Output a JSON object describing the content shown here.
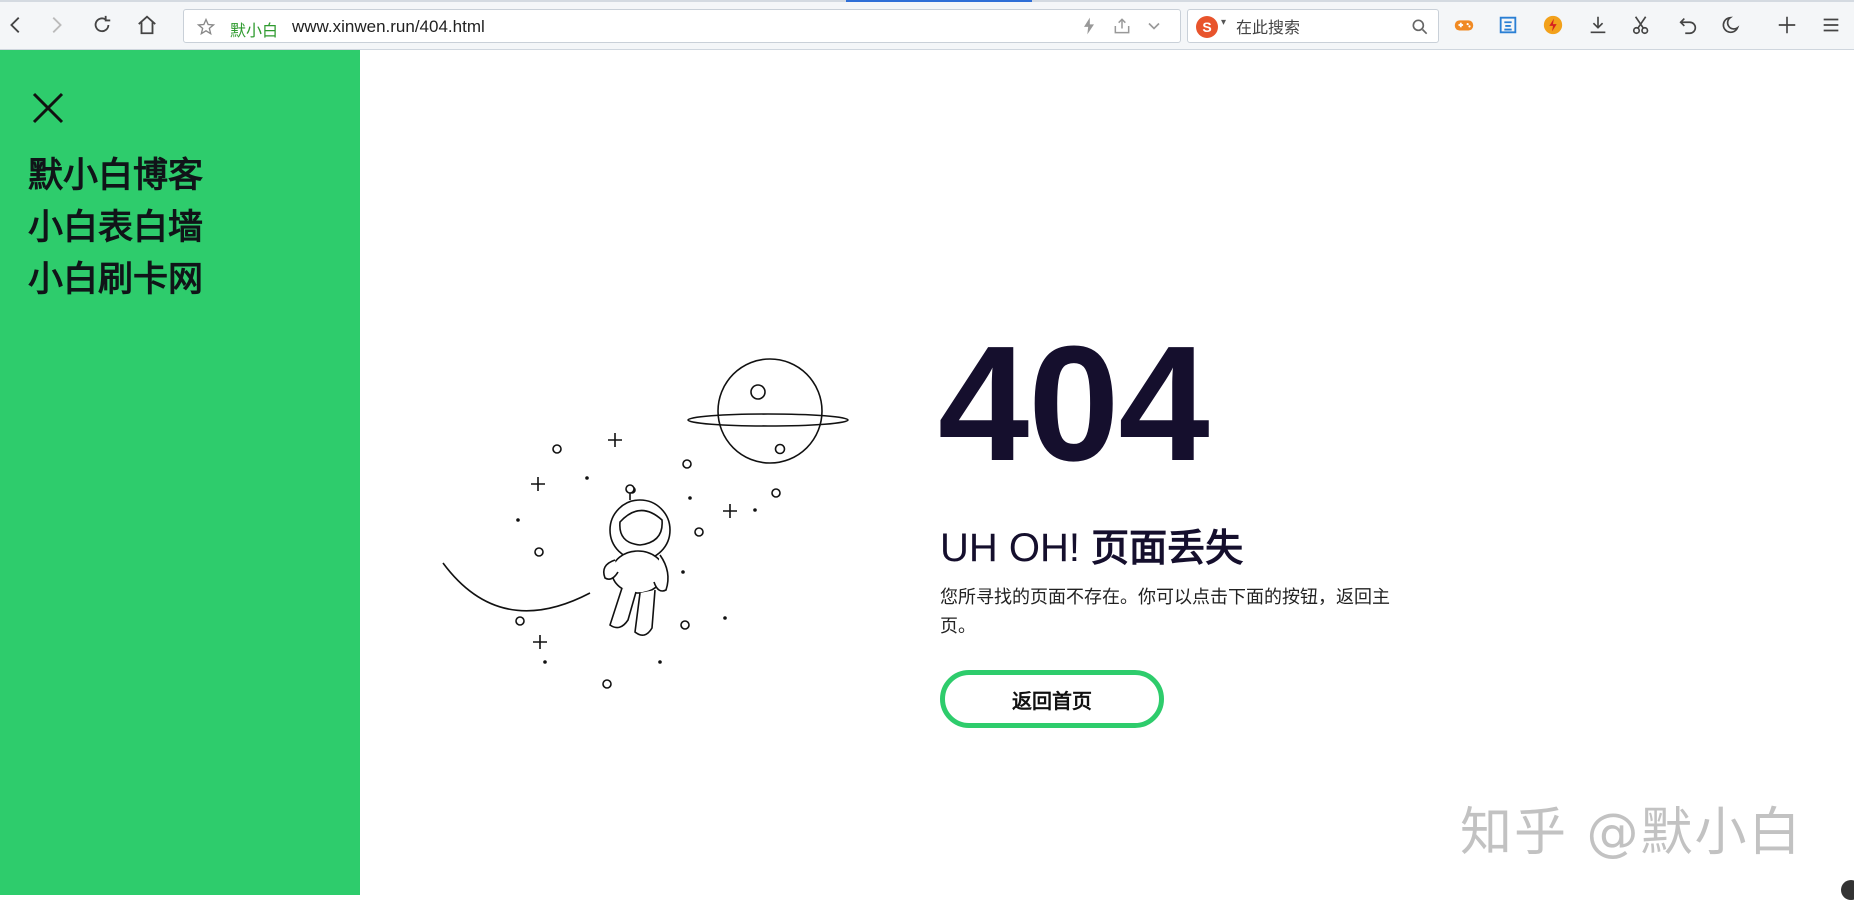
{
  "browser": {
    "site_label": "默小白",
    "url": "www.xinwen.run/404.html",
    "search_placeholder": "在此搜索",
    "search_engine_icon": "sogou-icon"
  },
  "sidebar": {
    "background": "#2ecc6c",
    "links": [
      {
        "label": "默小白博客"
      },
      {
        "label": "小白表白墙"
      },
      {
        "label": "小白刷卡网"
      }
    ]
  },
  "error": {
    "code": "404",
    "title_en": "UH OH! ",
    "title_cn": "页面丢失",
    "description": "您所寻找的页面不存在。你可以点击下面的按钮，返回主页。",
    "button_label": "返回首页",
    "accent": "#2ecc6c"
  },
  "watermark": "知乎 @默小白"
}
